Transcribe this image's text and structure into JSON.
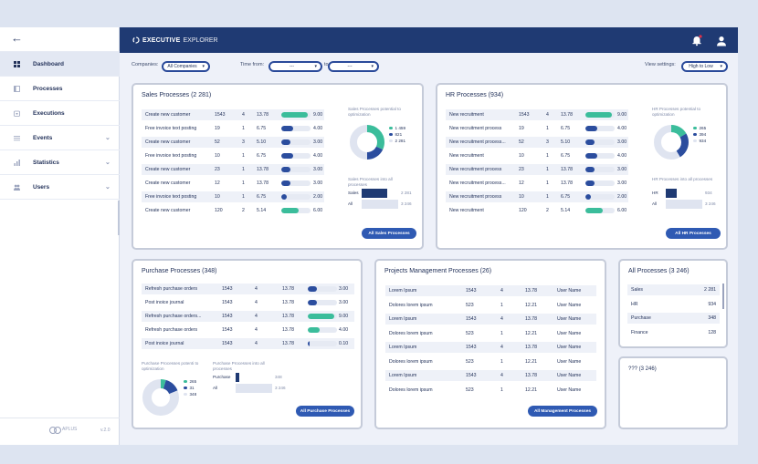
{
  "nav": {
    "items": [
      {
        "label": "Dashboard",
        "icon": "dashboard-icon",
        "active": true
      },
      {
        "label": "Processes",
        "icon": "processes-icon"
      },
      {
        "label": "Executions",
        "icon": "executions-icon"
      },
      {
        "label": "Events",
        "icon": "events-icon",
        "chevron": true
      },
      {
        "label": "Statistics",
        "icon": "statistics-icon",
        "chevron": true
      },
      {
        "label": "Users",
        "icon": "users-icon",
        "chevron": true
      }
    ],
    "logo": "APLUS",
    "version": "v.2.0"
  },
  "topbar": {
    "brand_bold": "EXECUTIVE",
    "brand_thin": "EXPLORER"
  },
  "filters": {
    "companies_label": "Companies:",
    "companies_value": "All Companies",
    "time_from_label": "Time from:",
    "from_value": "---",
    "to_label": "to",
    "to_value": "---",
    "view_label": "View settings:",
    "view_value": "High to Low"
  },
  "sales": {
    "title": "Sales Processes (2 281)",
    "rows": [
      {
        "name": "Create new customer",
        "a": "1543",
        "b": "4",
        "c": "13.78",
        "pct": 0.9,
        "color": "#3bbd9b",
        "v": "9.00"
      },
      {
        "name": "Free invoice text posting",
        "a": "19",
        "b": "1",
        "c": "6.75",
        "pct": 0.4,
        "color": "#2b4d9e",
        "v": "4.00"
      },
      {
        "name": "Create new customer",
        "a": "52",
        "b": "3",
        "c": "5.10",
        "pct": 0.3,
        "color": "#2b4d9e",
        "v": "3.00"
      },
      {
        "name": "Free invoice text posting",
        "a": "10",
        "b": "1",
        "c": "6.75",
        "pct": 0.4,
        "color": "#2b4d9e",
        "v": "4.00"
      },
      {
        "name": "Create new customer",
        "a": "23",
        "b": "1",
        "c": "13.78",
        "pct": 0.3,
        "color": "#2b4d9e",
        "v": "3.00"
      },
      {
        "name": "Create new customer",
        "a": "12",
        "b": "1",
        "c": "13.78",
        "pct": 0.3,
        "color": "#2b4d9e",
        "v": "3.00"
      },
      {
        "name": "Free invoice text posting",
        "a": "10",
        "b": "1",
        "c": "6.75",
        "pct": 0.2,
        "color": "#2b4d9e",
        "v": "2.00"
      },
      {
        "name": "Create new customer",
        "a": "120",
        "b": "2",
        "c": "5.14",
        "pct": 0.6,
        "color": "#3bbd9b",
        "v": "6.00"
      }
    ],
    "donut_title": "Sales Processes potential to optimization",
    "legend": [
      {
        "color": "#3bbd9b",
        "value": "1 459"
      },
      {
        "color": "#2b4d9e",
        "value": "821"
      },
      {
        "color": "#dfe4f0",
        "value": "2 281"
      }
    ],
    "donut": [
      {
        "value": 1459,
        "color": "#3bbd9b"
      },
      {
        "value": 821,
        "color": "#2b4d9e"
      },
      {
        "value": 2281,
        "color": "#dfe4f0"
      }
    ],
    "bars_title": "Sales Processes into all processes",
    "bars": [
      {
        "label": "Sales",
        "value": 2281,
        "display": "2 281",
        "color": "#1f3a73"
      },
      {
        "label": "All",
        "value": 3246,
        "display": "3 246",
        "color": "#dfe4f0"
      }
    ],
    "button": "All Sales Processes"
  },
  "hr": {
    "title": "HR Processes (934)",
    "rows": [
      {
        "name": "New recruitment",
        "a": "1543",
        "b": "4",
        "c": "13.78",
        "pct": 0.9,
        "color": "#3bbd9b",
        "v": "9.00"
      },
      {
        "name": "New recruitment process",
        "a": "19",
        "b": "1",
        "c": "6.75",
        "pct": 0.4,
        "color": "#2b4d9e",
        "v": "4.00"
      },
      {
        "name": "New recruitment process...",
        "a": "52",
        "b": "3",
        "c": "5.10",
        "pct": 0.3,
        "color": "#2b4d9e",
        "v": "3.00"
      },
      {
        "name": "New recruitment",
        "a": "10",
        "b": "1",
        "c": "6.75",
        "pct": 0.4,
        "color": "#2b4d9e",
        "v": "4.00"
      },
      {
        "name": "New recruitment process",
        "a": "23",
        "b": "1",
        "c": "13.78",
        "pct": 0.3,
        "color": "#2b4d9e",
        "v": "3.00"
      },
      {
        "name": "New recruitment process...",
        "a": "12",
        "b": "1",
        "c": "13.78",
        "pct": 0.3,
        "color": "#2b4d9e",
        "v": "3.00"
      },
      {
        "name": "New recruitment process",
        "a": "10",
        "b": "1",
        "c": "6.75",
        "pct": 0.2,
        "color": "#2b4d9e",
        "v": "2.00"
      },
      {
        "name": "New recruitment",
        "a": "120",
        "b": "2",
        "c": "5.14",
        "pct": 0.6,
        "color": "#3bbd9b",
        "v": "6.00"
      }
    ],
    "donut_title": "HR Processes potential to optimization",
    "legend": [
      {
        "color": "#3bbd9b",
        "value": "265"
      },
      {
        "color": "#2b4d9e",
        "value": "394"
      },
      {
        "color": "#dfe4f0",
        "value": "934"
      }
    ],
    "donut": [
      {
        "value": 265,
        "color": "#3bbd9b"
      },
      {
        "value": 394,
        "color": "#2b4d9e"
      },
      {
        "value": 934,
        "color": "#dfe4f0"
      }
    ],
    "bars_title": "HR Processes into all processes",
    "bars": [
      {
        "label": "HR",
        "value": 934,
        "display": "934",
        "color": "#1f3a73"
      },
      {
        "label": "All",
        "value": 3246,
        "display": "3 246",
        "color": "#dfe4f0"
      }
    ],
    "button": "All HR Processes"
  },
  "purchase": {
    "title": "Purchase Processes (348)",
    "rows": [
      {
        "name": "Refresh purchase orders",
        "a": "1543",
        "b": "4",
        "c": "13.78",
        "pct": 0.3,
        "color": "#2b4d9e",
        "v": "3.00"
      },
      {
        "name": "Post inoice journal",
        "a": "1543",
        "b": "4",
        "c": "13.78",
        "pct": 0.3,
        "color": "#2b4d9e",
        "v": "3.00"
      },
      {
        "name": "Refresh purchase orders...",
        "a": "1543",
        "b": "4",
        "c": "13.78",
        "pct": 0.9,
        "color": "#3bbd9b",
        "v": "9.00"
      },
      {
        "name": "Refresh purchase orders",
        "a": "1543",
        "b": "4",
        "c": "13.78",
        "pct": 0.4,
        "color": "#3bbd9b",
        "v": "4.00"
      },
      {
        "name": "Post inoice journal",
        "a": "1543",
        "b": "4",
        "c": "13.78",
        "pct": 0.01,
        "color": "#2b4d9e",
        "v": "0.10"
      }
    ],
    "donut_title": "Purchase Processes potenti to optimization",
    "legend": [
      {
        "color": "#3bbd9b",
        "value": "265"
      },
      {
        "color": "#2b4d9e",
        "value": "31"
      },
      {
        "color": "#dfe4f0",
        "value": "348"
      }
    ],
    "donut": [
      {
        "value": 20,
        "color": "#3bbd9b"
      },
      {
        "value": 60,
        "color": "#2b4d9e"
      },
      {
        "value": 348,
        "color": "#dfe4f0"
      }
    ],
    "bars_title": "Purchase Processes into all processes",
    "bars": [
      {
        "label": "Purchase",
        "value": 348,
        "display": "348",
        "color": "#1f3a73"
      },
      {
        "label": "All",
        "value": 3246,
        "display": "3 246",
        "color": "#dfe4f0"
      }
    ],
    "button": "All Purchase Processes"
  },
  "projects": {
    "title": "Projects Management Processes (26)",
    "rows": [
      {
        "name": "Lorem Ipsum",
        "a": "1543",
        "b": "4",
        "c": "13.78",
        "user": "User Name"
      },
      {
        "name": "Dolores lorem ipsum",
        "a": "523",
        "b": "1",
        "c": "12.21",
        "user": "User Name"
      },
      {
        "name": "Lorem Ipsum",
        "a": "1543",
        "b": "4",
        "c": "13.78",
        "user": "User Name"
      },
      {
        "name": "Dolores lorem ipsum",
        "a": "523",
        "b": "1",
        "c": "12.21",
        "user": "User Name"
      },
      {
        "name": "Lorem Ipsum",
        "a": "1543",
        "b": "4",
        "c": "13.78",
        "user": "User Name"
      },
      {
        "name": "Dolores lorem ipsum",
        "a": "523",
        "b": "1",
        "c": "12.21",
        "user": "User Name"
      },
      {
        "name": "Lorem Ipsum",
        "a": "1543",
        "b": "4",
        "c": "13.78",
        "user": "User Name"
      },
      {
        "name": "Dolores lorem ipsum",
        "a": "523",
        "b": "1",
        "c": "12.21",
        "user": "User Name"
      }
    ],
    "button": "All Management Processes"
  },
  "all": {
    "title": "All Processes (3 246)",
    "rows": [
      {
        "label": "Sales",
        "value": "2 281"
      },
      {
        "label": "HR",
        "value": "934"
      },
      {
        "label": "Purchase",
        "value": "348"
      },
      {
        "label": "Finance",
        "value": "128"
      }
    ]
  },
  "unknown": {
    "title": "??? (3 246)"
  }
}
